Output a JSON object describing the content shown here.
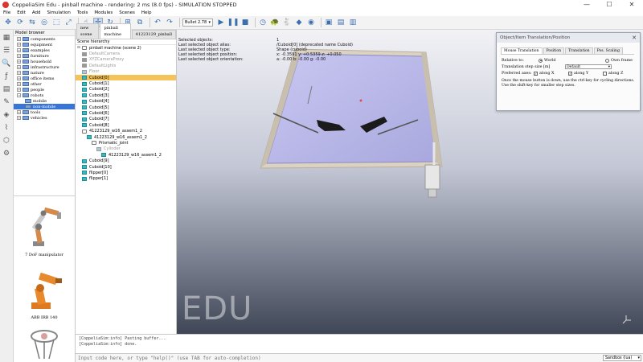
{
  "window": {
    "title": "CoppeliaSim Edu - pinball machine - rendering: 2 ms (8.0 fps) - SIMULATION STOPPED",
    "minimize": "—",
    "maximize": "☐",
    "close": "✕"
  },
  "menu": [
    "File",
    "Edit",
    "Add",
    "Simulation",
    "Tools",
    "Modules",
    "Scenes",
    "Help"
  ],
  "toolbar": {
    "engine": "Bullet 2.78"
  },
  "model_browser": {
    "header": "Model browser",
    "items": [
      {
        "label": "components"
      },
      {
        "label": "equipment"
      },
      {
        "label": "examples"
      },
      {
        "label": "furniture"
      },
      {
        "label": "household"
      },
      {
        "label": "infrastructure"
      },
      {
        "label": "nature"
      },
      {
        "label": "office items"
      },
      {
        "label": "other"
      },
      {
        "label": "people"
      },
      {
        "label": "robots"
      }
    ],
    "robot_children": [
      "mobile",
      "non-mobile"
    ],
    "more_items": [
      "tools",
      "vehicles"
    ],
    "thumbnails": [
      "7 DoF manipulator",
      "ABB IRB 140"
    ]
  },
  "scene_tabs": [
    "new scene",
    "pinball machine",
    "41223129_pinball"
  ],
  "hierarchy": {
    "header": "Scene hierarchy",
    "root": "pinball machine (scene 2)",
    "items": [
      {
        "label": "DefaultCamera",
        "kind": "cam",
        "level": 1,
        "gray": true
      },
      {
        "label": "XYZCameraProxy",
        "kind": "cam",
        "level": 1,
        "gray": true
      },
      {
        "label": "DefaultLights",
        "kind": "cam",
        "level": 1,
        "gray": true
      },
      {
        "label": "Floor",
        "kind": "cube-gray",
        "level": 1,
        "gray": true
      },
      {
        "label": "Cuboid[0]",
        "kind": "cube",
        "level": 1,
        "selected": true
      },
      {
        "label": "Cuboid[1]",
        "kind": "cube",
        "level": 1
      },
      {
        "label": "Cuboid[2]",
        "kind": "cube",
        "level": 1
      },
      {
        "label": "Cuboid[3]",
        "kind": "cube",
        "level": 1
      },
      {
        "label": "Cuboid[4]",
        "kind": "cube",
        "level": 1
      },
      {
        "label": "Cuboid[5]",
        "kind": "cube",
        "level": 1
      },
      {
        "label": "Cuboid[6]",
        "kind": "cube",
        "level": 1
      },
      {
        "label": "Cuboid[7]",
        "kind": "cube",
        "level": 1
      },
      {
        "label": "Cuboid[8]",
        "kind": "cube",
        "level": 1
      },
      {
        "label": "41223129_w16_assem1_2",
        "kind": "shape",
        "level": 1
      },
      {
        "label": "41223129_w16_assem1_2",
        "kind": "cube",
        "level": 2
      },
      {
        "label": "Prismatic_joint",
        "kind": "shape",
        "level": 3
      },
      {
        "label": "Cylinder",
        "kind": "cube-gray",
        "level": 4,
        "gray": true
      },
      {
        "label": "41223129_w16_assem1_2",
        "kind": "cube",
        "level": 5
      },
      {
        "label": "Cuboid[9]",
        "kind": "cube",
        "level": 1
      },
      {
        "label": "Cuboid[10]",
        "kind": "cube",
        "level": 1
      },
      {
        "label": "flipper[0]",
        "kind": "cube",
        "level": 1
      },
      {
        "label": "flipper[1]",
        "kind": "cube",
        "level": 1
      }
    ]
  },
  "selection_info": [
    {
      "label": "Selected objects:",
      "value": "1"
    },
    {
      "label": "Last selected object alias:",
      "value": "/Cuboid[0]    (deprecated name Cuboid)"
    },
    {
      "label": "Last selected object type:",
      "value": "Shape (cuboid)"
    },
    {
      "label": "Last selected object position:",
      "value": "x: -0.3591    y: +0.5359    z: +0.050"
    },
    {
      "label": "Last selected object orientation:",
      "value": "a: -0.00    b: -0.00    g: -0.00"
    }
  ],
  "watermark": "EDU",
  "dialog": {
    "title": "Object/Item Translation/Position",
    "tabs": [
      "Mouse Translation",
      "Position",
      "Translation",
      "Pos. Scaling"
    ],
    "relative_to_label": "Relative to:",
    "world_label": "World",
    "own_frame_label": "Own frame",
    "step_label": "Translation step size [m]",
    "step_value": "Default",
    "preferred_axes_label": "Preferred axes:",
    "axes": [
      {
        "label": "along X",
        "checked": true
      },
      {
        "label": "along Y",
        "checked": true
      },
      {
        "label": "along Z",
        "checked": false
      }
    ],
    "note": "Once the mouse button is down, use the ctrl-key for cycling directions. Use the shift-key for smaller step sizes."
  },
  "console": {
    "lines": [
      "[CoppeliaSim:info]  Pasting buffer...",
      "[CoppeliaSim:info]  done."
    ],
    "input_placeholder": "Input code here, or type \"help()\" (use TAB for auto-completion)",
    "sandbox": "Sandbox (lua)"
  }
}
